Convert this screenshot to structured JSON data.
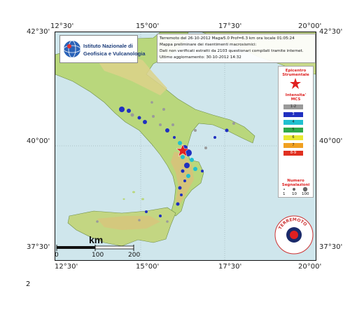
{
  "map": {
    "lat_labels_left": [
      "42°30'",
      "40°00'",
      "37°30'"
    ],
    "lat_labels_right": [
      "42°30'",
      "40°00'",
      "37°30'"
    ],
    "lon_labels_top": [
      "12°30'",
      "15°00'",
      "17°30'",
      "20°00'"
    ],
    "lon_labels_bottom": [
      "12°30'",
      "15°00'",
      "17°30'",
      "20°00'"
    ],
    "colors": {
      "sea": "#cfe6ec",
      "land_low": "#b5d67a",
      "land_mid": "#e3d88a",
      "land_high": "#c9a061",
      "marker_blue": "#2030c0",
      "marker_cyan": "#20c0d0",
      "marker_gray": "#9a9a9a",
      "epicenter": "#e02020"
    }
  },
  "logo": {
    "line1": "Istituto Nazionale di",
    "line2": "Geofisica e Vulcanologia"
  },
  "info": {
    "lines": [
      "Terremoto del 26-10-2012 Magw5.0 Prof=6.3 km ora locale 01:05:24",
      "Mappa preliminare dei risentimenti macrosismici:",
      "Dati non verificati estratti da 2103 questionari compilati tramite internet.",
      "Ultimo aggiornamento: 30-10-2012 14:32"
    ]
  },
  "legend": {
    "epicenter_title": "Epicentro\nStrumentale",
    "intensity_title": "Intensita'\nMCS",
    "intensity_classes": [
      {
        "label": "1-2",
        "color": "#9a9a9a"
      },
      {
        "label": "3",
        "color": "#2030c0"
      },
      {
        "label": "4",
        "color": "#20c0d0"
      },
      {
        "label": "5",
        "color": "#2fa84a"
      },
      {
        "label": "6",
        "color": "#e8e830"
      },
      {
        "label": "7",
        "color": "#f0a020"
      },
      {
        "label": "8-9",
        "color": "#e03020"
      }
    ],
    "count_title": "Numero\nSegnalazioni",
    "count_values": [
      "1",
      "10",
      "100"
    ]
  },
  "scale": {
    "unit": "km",
    "ticks": [
      "0",
      "100",
      "200"
    ]
  },
  "seal": {
    "text": "TERREMOTO"
  },
  "page": {
    "number": "2"
  }
}
